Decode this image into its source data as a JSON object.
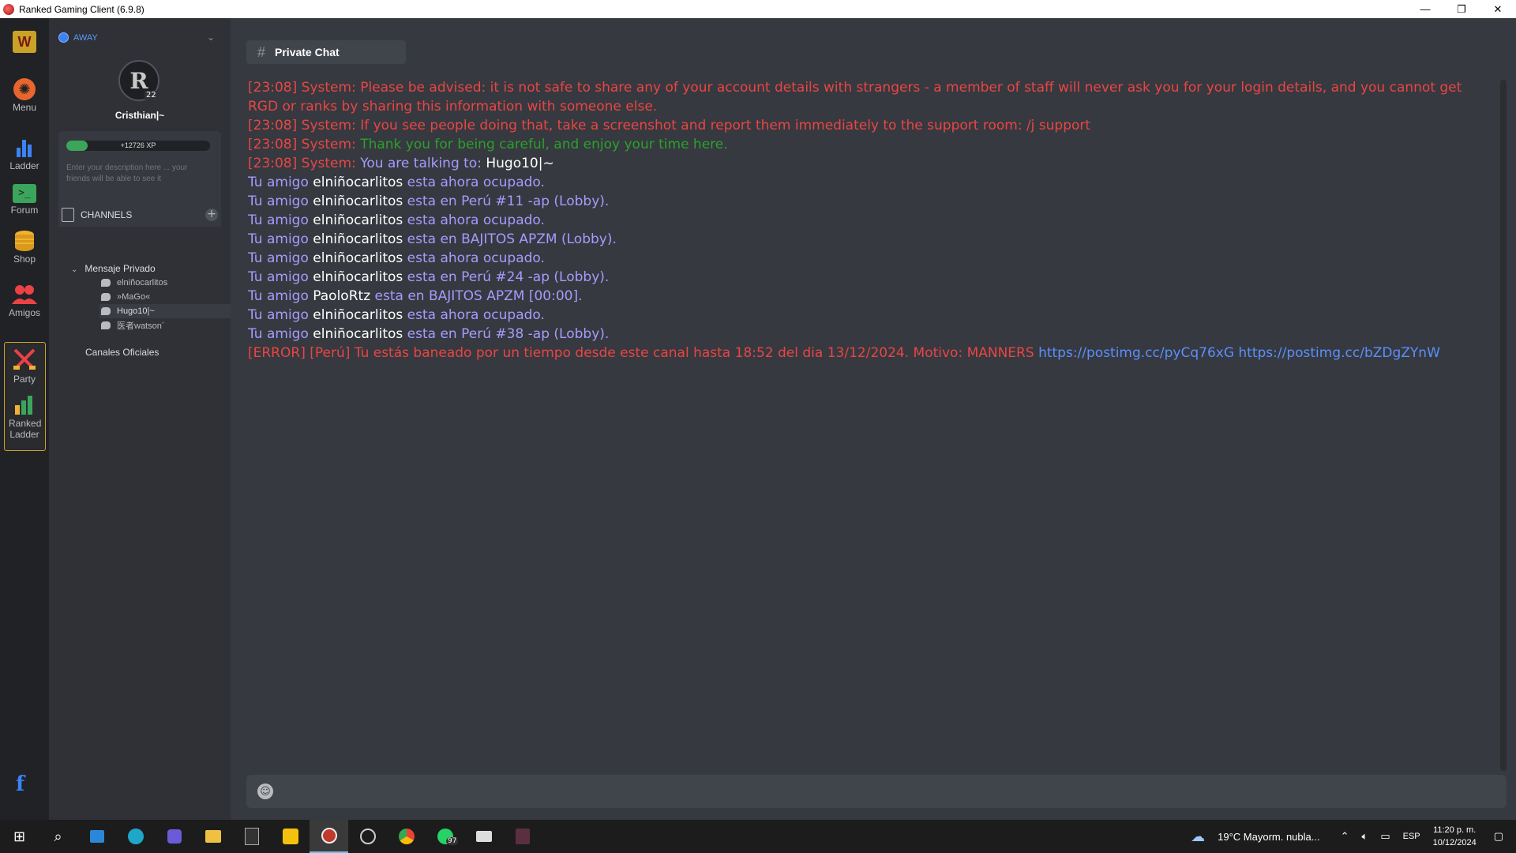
{
  "window": {
    "title": "Ranked Gaming Client (6.9.8)",
    "controls": {
      "minimize": "—",
      "restore": "❐",
      "close": "✕"
    }
  },
  "rail": {
    "items": [
      {
        "label": "Menu",
        "icon": "gear-icon"
      },
      {
        "label": "Ladder",
        "icon": "bar-chart-icon"
      },
      {
        "label": "Forum",
        "icon": "terminal-icon"
      },
      {
        "label": "Shop",
        "icon": "coins-icon"
      },
      {
        "label": "Amigos",
        "icon": "users-icon"
      },
      {
        "label": "Party",
        "icon": "crossed-swords-icon"
      },
      {
        "label": "Ranked Ladder",
        "icon": "ranked-bars-icon"
      }
    ],
    "facebook": "f"
  },
  "profile": {
    "status": "AWAY",
    "username": "Cristhian|~",
    "level": "22",
    "xp_text": "+12726 XP",
    "xp_fraction": 0.15,
    "description_placeholder": "Enter your description here ... your friends will be able to see it"
  },
  "channels": {
    "header": "CHANNELS",
    "add": "+",
    "groups": [
      {
        "name": "Mensaje Privado",
        "expanded": true,
        "items": [
          "elniñocarlitos",
          "»MaGo«",
          "Hugo10|~",
          "医者watson´"
        ],
        "active_index": 2
      },
      {
        "name": "Canales Oficiales",
        "expanded": false,
        "items": []
      }
    ]
  },
  "chat": {
    "tab_title": "Private Chat",
    "tab_hash": "#",
    "messages": [
      {
        "parts": [
          {
            "t": "[23:08] System: ",
            "c": "red"
          },
          {
            "t": "Please be advised: it is not safe to share any of your account details with strangers - a member of staff will never ask you for your login details, and you cannot get RGD or ranks by sharing this information with someone else.",
            "c": "red"
          }
        ]
      },
      {
        "parts": [
          {
            "t": "[23:08] System: ",
            "c": "red"
          },
          {
            "t": "If you see people doing that, take a screenshot and report them immediately to the support room: /j support",
            "c": "red"
          }
        ]
      },
      {
        "parts": [
          {
            "t": "[23:08] System: ",
            "c": "red"
          },
          {
            "t": "Thank you for being careful, and enjoy your time here.",
            "c": "green"
          }
        ]
      },
      {
        "parts": [
          {
            "t": "[23:08] System: ",
            "c": "red"
          },
          {
            "t": "You are talking to: ",
            "c": "purple"
          },
          {
            "t": "Hugo10|~",
            "c": "white"
          }
        ]
      },
      {
        "parts": [
          {
            "t": "Tu amigo ",
            "c": "purple"
          },
          {
            "t": "elniñocarlitos",
            "c": "white"
          },
          {
            "t": " esta ahora ocupado.",
            "c": "purple"
          }
        ]
      },
      {
        "parts": [
          {
            "t": "Tu amigo ",
            "c": "purple"
          },
          {
            "t": "elniñocarlitos",
            "c": "white"
          },
          {
            "t": " esta en Perú  #11 -ap (Lobby).",
            "c": "purple"
          }
        ]
      },
      {
        "parts": [
          {
            "t": "Tu amigo ",
            "c": "purple"
          },
          {
            "t": "elniñocarlitos",
            "c": "white"
          },
          {
            "t": " esta ahora ocupado.",
            "c": "purple"
          }
        ]
      },
      {
        "parts": [
          {
            "t": "Tu amigo ",
            "c": "purple"
          },
          {
            "t": "elniñocarlitos",
            "c": "white"
          },
          {
            "t": " esta en BAJITOS APZM (Lobby).",
            "c": "purple"
          }
        ]
      },
      {
        "parts": [
          {
            "t": "Tu amigo ",
            "c": "purple"
          },
          {
            "t": "elniñocarlitos",
            "c": "white"
          },
          {
            "t": " esta ahora ocupado.",
            "c": "purple"
          }
        ]
      },
      {
        "parts": [
          {
            "t": "Tu amigo ",
            "c": "purple"
          },
          {
            "t": "elniñocarlitos",
            "c": "white"
          },
          {
            "t": " esta en Perú  #24 -ap (Lobby).",
            "c": "purple"
          }
        ]
      },
      {
        "parts": [
          {
            "t": "Tu amigo ",
            "c": "purple"
          },
          {
            "t": "PaoloRtz",
            "c": "white"
          },
          {
            "t": " esta en BAJITOS APZM [00:00].",
            "c": "purple"
          }
        ]
      },
      {
        "parts": [
          {
            "t": "Tu amigo ",
            "c": "purple"
          },
          {
            "t": "elniñocarlitos",
            "c": "white"
          },
          {
            "t": " esta ahora ocupado.",
            "c": "purple"
          }
        ]
      },
      {
        "parts": [
          {
            "t": "Tu amigo ",
            "c": "purple"
          },
          {
            "t": "elniñocarlitos",
            "c": "white"
          },
          {
            "t": " esta en Perú  #38 -ap (Lobby).",
            "c": "purple"
          }
        ]
      },
      {
        "parts": [
          {
            "t": "[ERROR] [Perú] Tu estás baneado por un tiempo desde este canal hasta 18:52 del dia 13/12/2024. Motivo: MANNERS ",
            "c": "red"
          },
          {
            "t": "https://postimg.cc/pyCq76xG",
            "c": "link"
          },
          {
            "t": " ",
            "c": "red"
          },
          {
            "t": "https://postimg.cc/bZDgZYnW",
            "c": "link"
          }
        ]
      }
    ],
    "input_placeholder": ""
  },
  "colors": {
    "red": "#ea4545",
    "green": "#2ca02c",
    "purple": "#a79bff",
    "white": "#ffffff",
    "link": "#5b8fff",
    "accent": "#3b82f6"
  },
  "taskbar": {
    "apps": [
      "windows-start-icon",
      "search-icon",
      "store-icon",
      "edge-icon",
      "video-editor-icon",
      "file-explorer-icon",
      "epic-games-icon",
      "rockstar-icon",
      "ranked-gaming-icon",
      "steam-like-icon",
      "chrome-icon",
      "whatsapp-icon",
      "mail-icon",
      "game-icon"
    ],
    "active_index": 8,
    "whatsapp_badge": "97",
    "weather": "19°C  Mayorm. nubla...",
    "lang": "ESP",
    "time": "11:20 p. m.",
    "date": "10/12/2024"
  }
}
